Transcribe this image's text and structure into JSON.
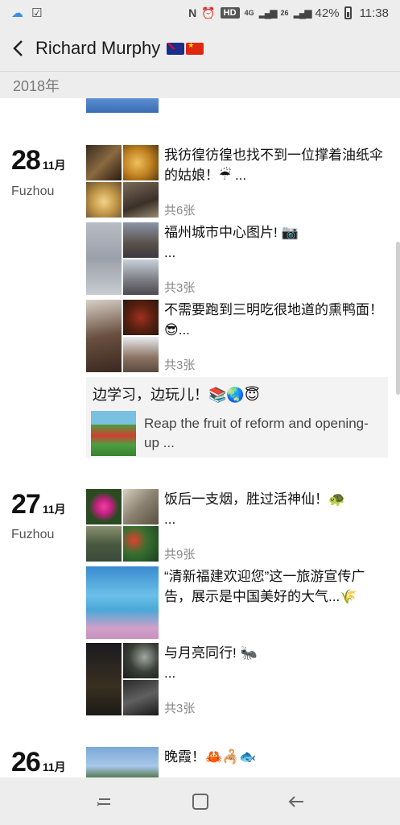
{
  "status_bar": {
    "network": "4G",
    "network_sub": "26",
    "hd_badge": "HD",
    "battery": "42%",
    "time": "11:38"
  },
  "header": {
    "back_icon": "chevron-left",
    "title": "Richard Murphy",
    "flags": [
      "australia-flag",
      "china-flag"
    ]
  },
  "year_label": "2018年",
  "days": [
    {
      "day": "28",
      "month": "11月",
      "location": "Fuzhou",
      "posts": [
        {
          "text": "我彷徨彷徨也找不到一位撑着油纸伞的姑娘！☔ ...",
          "count": "共6张"
        },
        {
          "text": "福州城市中心图片! 📷\n...",
          "count": "共3张"
        },
        {
          "text": "不需要跑到三明吃很地道的熏鸭面！😎...",
          "count": "共3张"
        }
      ],
      "share": {
        "title": "边学习，边玩儿！📚🌏😇",
        "text": "Reap the fruit of reform and opening-up ..."
      }
    },
    {
      "day": "27",
      "month": "11月",
      "location": "Fuzhou",
      "posts": [
        {
          "text": "饭后一支烟，胜过活神仙！🐢\n...",
          "count": "共9张"
        },
        {
          "text": "“清新福建欢迎您”这一旅游宣传广告，展示是中国美好的大气...🌾",
          "count": ""
        },
        {
          "text": "与月亮同行! 🐜\n...",
          "count": "共3张"
        }
      ]
    },
    {
      "day": "26",
      "month": "11月",
      "location": "",
      "posts": [
        {
          "text": "晚霞！🦀🦂🐟",
          "count": ""
        }
      ]
    }
  ]
}
